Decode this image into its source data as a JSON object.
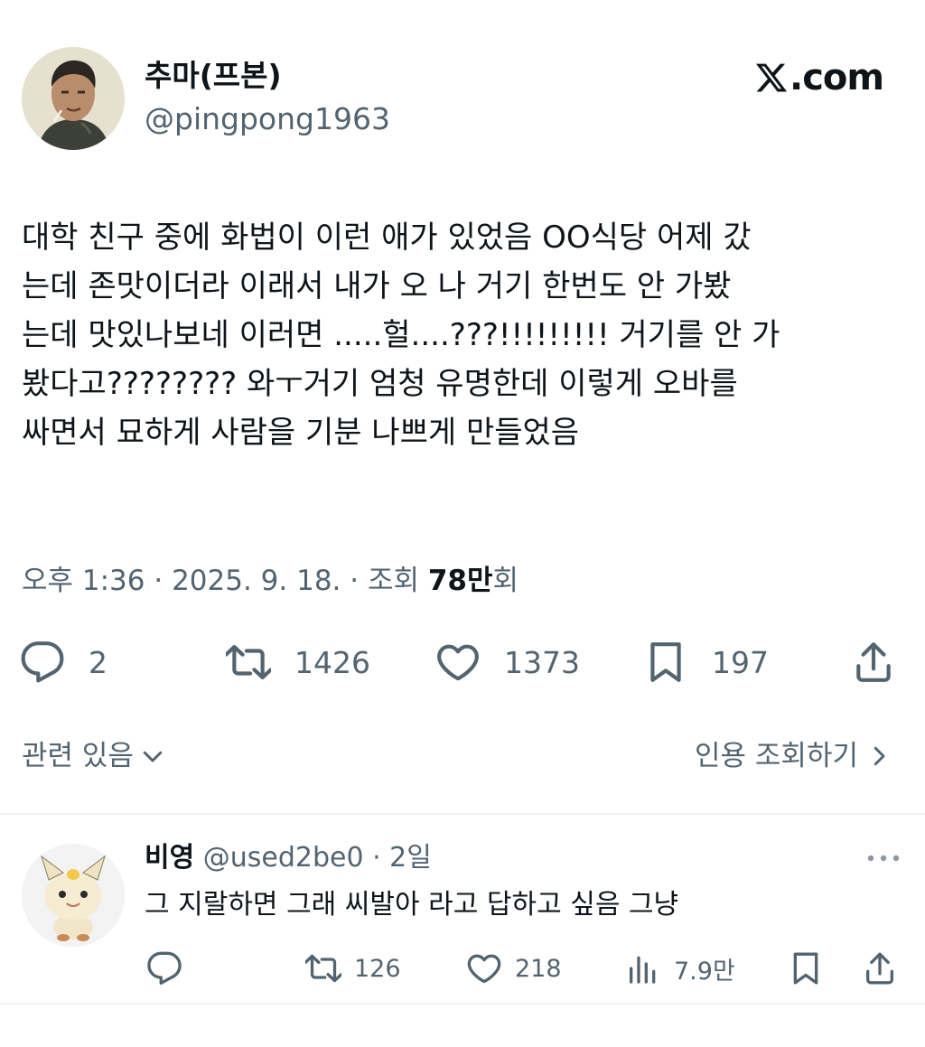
{
  "author": {
    "name": "추마(프본)",
    "handle": "@pingpong1963"
  },
  "brand": {
    "label": ".com"
  },
  "tweet": {
    "text": "대학 친구 중에 화법이 이런 애가 있었음 OO식당 어제 갔\n는데 존맛이더라 이래서 내가 오 나 거기 한번도 안 가봤\n는데 맛있나보네 이러면 .....헐....???!!!!!!!!! 거기를 안 가\n봤다고???????? 와ㅜ거기 엄청 유명한데 이렇게 오바를\n싸면서 묘하게 사람을 기분 나쁘게 만들었음"
  },
  "meta": {
    "time_date": "오후 1:36 · 2025. 9. 18. · 조회 ",
    "views_value": "78만",
    "views_suffix": "회"
  },
  "actions": {
    "replies": "2",
    "reposts": "1426",
    "likes": "1373",
    "bookmarks": "197"
  },
  "related_label": "관련 있음",
  "quotes_label": "인용 조회하기",
  "reply": {
    "name": "비영",
    "meta": "@used2be0 · 2일",
    "text": "그 지랄하면 그래 씨발아 라고 답하고 싶음 그냥",
    "reposts": "126",
    "likes": "218",
    "views": "7.9만"
  },
  "icons": [
    "reply-icon",
    "repost-icon",
    "like-icon",
    "bookmark-icon",
    "share-icon",
    "views-icon",
    "more-icon",
    "chevron-down-icon",
    "chevron-right-icon",
    "x-logo-icon"
  ]
}
